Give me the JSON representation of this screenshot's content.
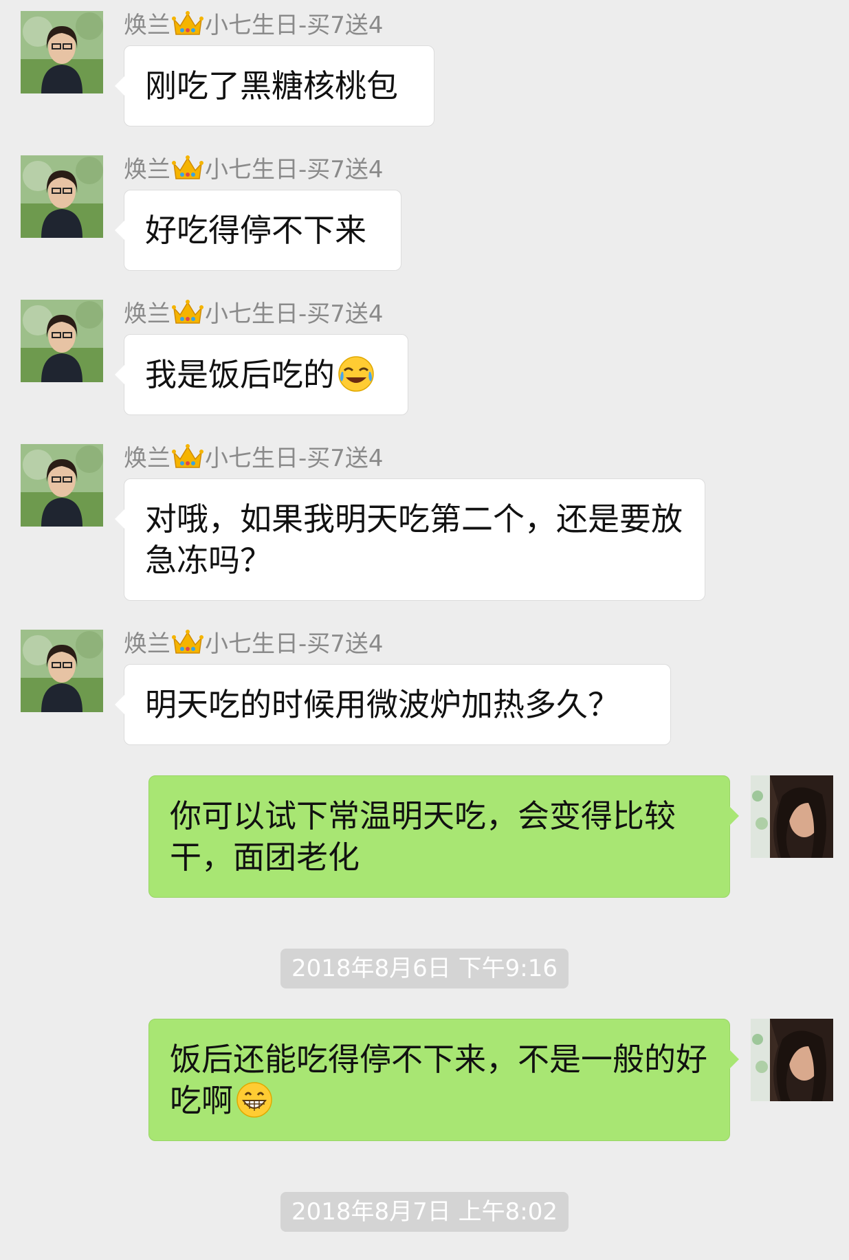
{
  "sender_prefix": "焕兰",
  "sender_suffix": "小七生日-买7送4",
  "messages": [
    {
      "text": "刚吃了黑糖核桃包"
    },
    {
      "text": "好吃得停不下来"
    },
    {
      "text": "我是饭后吃的",
      "emoji": "tears-of-joy-emoji"
    },
    {
      "text": "对哦，如果我明天吃第二个，还是要放急冻吗？"
    },
    {
      "text": "明天吃的时候用微波炉加热多久？"
    },
    {
      "text": "你可以试下常温明天吃，会变得比较干，面团老化"
    },
    {
      "text": "饭后还能吃得停不下来，不是一般的好吃啊",
      "emoji": "grinning-face-emoji"
    }
  ],
  "timestamps": [
    "2018年8月6日 下午9:16",
    "2018年8月7日 上午8:02"
  ],
  "colors": {
    "background": "#ededed",
    "incoming_bubble": "#ffffff",
    "outgoing_bubble": "#a8e673",
    "sender_name": "#8a8a8a",
    "timestamp_bg": "#d4d4d4"
  },
  "icons": {
    "crown": "crown-icon",
    "contact_avatar": "contact-avatar",
    "self_avatar": "self-avatar"
  }
}
